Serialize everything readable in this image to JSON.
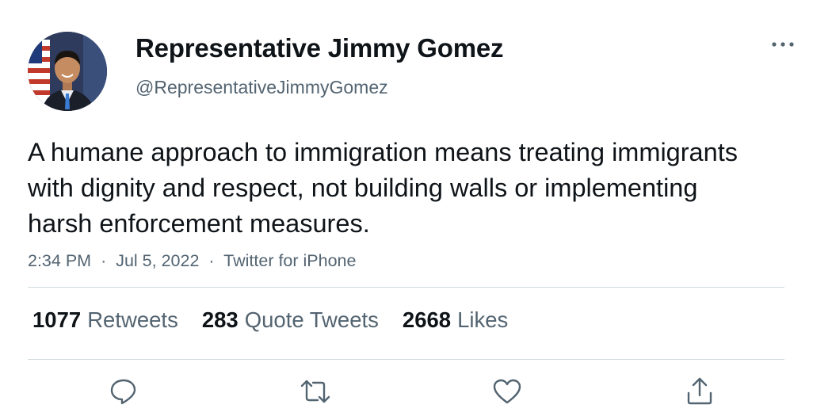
{
  "author": {
    "display_name": "Representative Jimmy Gomez",
    "handle": "@RepresentativeJimmyGomez",
    "avatar": "profile-photo"
  },
  "tweet": {
    "text": "A humane approach to immigration means treating immigrants with dignity and respect, not building walls or implementing harsh enforcement measures.",
    "time": "2:34 PM",
    "date": "Jul 5, 2022",
    "source": "Twitter for iPhone",
    "separator": "·"
  },
  "stats": {
    "retweets": {
      "count": "1077",
      "label": "Retweets"
    },
    "quote_tweets": {
      "count": "283",
      "label": "Quote Tweets"
    },
    "likes": {
      "count": "2668",
      "label": "Likes"
    }
  },
  "actions": {
    "reply": "reply-icon",
    "retweet": "retweet-icon",
    "like": "heart-icon",
    "share": "share-icon"
  },
  "colors": {
    "text": "#0f1419",
    "secondary": "#536471",
    "divider": "#cfd9de",
    "background": "#ffffff"
  }
}
